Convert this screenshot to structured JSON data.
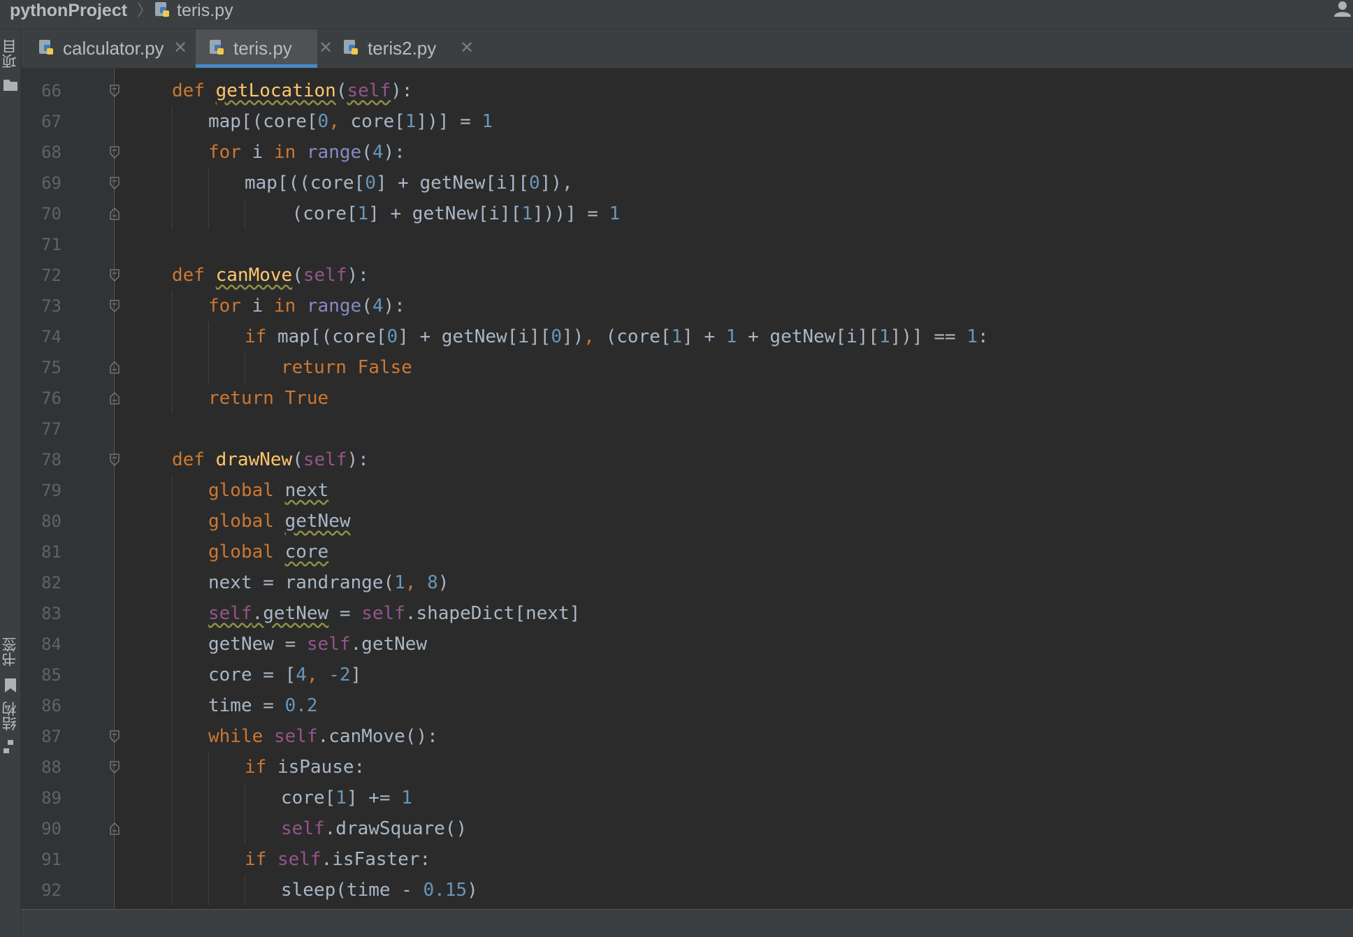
{
  "breadcrumb": {
    "project": "pythonProject",
    "file": "teris.py"
  },
  "tool_windows": {
    "project_label": "项目",
    "bookmarks_label": "书签",
    "structure_label": "结构"
  },
  "tabs": [
    {
      "label": "calculator.py",
      "active": false
    },
    {
      "label": "teris.py",
      "active": true
    },
    {
      "label": "teris2.py",
      "active": false
    }
  ],
  "colors": {
    "editor_bg": "#2b2b2b",
    "chrome_bg": "#3c3f41",
    "keyword": "#cc7832",
    "number": "#6897bb",
    "self": "#94558d",
    "function": "#ffc66d",
    "builtin": "#8888c6",
    "default": "#a9b7c6",
    "active_tab_underline": "#4a88c7"
  },
  "icons": [
    "python-file-icon",
    "close-icon",
    "user-icon",
    "folder-icon",
    "bookmark-icon",
    "structure-icon",
    "fold-icon"
  ],
  "code_lines": [
    {
      "n": "66",
      "indent": 1,
      "fold": "open",
      "tokens": [
        [
          "kw",
          "def"
        ],
        [
          "p",
          " "
        ],
        [
          "fnw",
          "getLocation"
        ],
        [
          "p",
          "("
        ],
        [
          "selfw",
          "self"
        ],
        [
          "p",
          "):"
        ]
      ]
    },
    {
      "n": "67",
      "indent": 2,
      "fold": "",
      "tokens": [
        [
          "p",
          "map[(core["
        ],
        [
          "num",
          "0"
        ],
        [
          "kw",
          ", "
        ],
        [
          "p",
          "core["
        ],
        [
          "num",
          "1"
        ],
        [
          "p",
          "])] = "
        ],
        [
          "num",
          "1"
        ]
      ]
    },
    {
      "n": "68",
      "indent": 2,
      "fold": "open",
      "tokens": [
        [
          "kw",
          "for"
        ],
        [
          "p",
          " i "
        ],
        [
          "kw",
          "in"
        ],
        [
          "p",
          " "
        ],
        [
          "bi",
          "range"
        ],
        [
          "p",
          "("
        ],
        [
          "num",
          "4"
        ],
        [
          "p",
          "):"
        ]
      ]
    },
    {
      "n": "69",
      "indent": 3,
      "fold": "open",
      "tokens": [
        [
          "p",
          "map[((core["
        ],
        [
          "num",
          "0"
        ],
        [
          "p",
          "] + getNew[i]["
        ],
        [
          "num",
          "0"
        ],
        [
          "p",
          "]),"
        ]
      ]
    },
    {
      "n": "70",
      "indent": 4.3,
      "fold": "close",
      "tokens": [
        [
          "p",
          "(core["
        ],
        [
          "num",
          "1"
        ],
        [
          "p",
          "] + getNew[i]["
        ],
        [
          "num",
          "1"
        ],
        [
          "p",
          "]))] = "
        ],
        [
          "num",
          "1"
        ]
      ]
    },
    {
      "n": "71",
      "indent": 0,
      "fold": "",
      "tokens": []
    },
    {
      "n": "72",
      "indent": 1,
      "fold": "open",
      "tokens": [
        [
          "kw",
          "def"
        ],
        [
          "p",
          " "
        ],
        [
          "fnw",
          "canMove"
        ],
        [
          "p",
          "("
        ],
        [
          "self",
          "self"
        ],
        [
          "p",
          "):"
        ]
      ]
    },
    {
      "n": "73",
      "indent": 2,
      "fold": "open",
      "tokens": [
        [
          "kw",
          "for"
        ],
        [
          "p",
          " i "
        ],
        [
          "kw",
          "in"
        ],
        [
          "p",
          " "
        ],
        [
          "bi",
          "range"
        ],
        [
          "p",
          "("
        ],
        [
          "num",
          "4"
        ],
        [
          "p",
          "):"
        ]
      ]
    },
    {
      "n": "74",
      "indent": 3,
      "fold": "",
      "tokens": [
        [
          "kw",
          "if"
        ],
        [
          "p",
          " map[(core["
        ],
        [
          "num",
          "0"
        ],
        [
          "p",
          "] + getNew[i]["
        ],
        [
          "num",
          "0"
        ],
        [
          "p",
          "])"
        ],
        [
          "kw",
          ", "
        ],
        [
          "p",
          "(core["
        ],
        [
          "num",
          "1"
        ],
        [
          "p",
          "] + "
        ],
        [
          "num",
          "1"
        ],
        [
          "p",
          " + getNew[i]["
        ],
        [
          "num",
          "1"
        ],
        [
          "p",
          "])] == "
        ],
        [
          "num",
          "1"
        ],
        [
          "p",
          ":"
        ]
      ]
    },
    {
      "n": "75",
      "indent": 4,
      "fold": "close",
      "tokens": [
        [
          "kw",
          "return False"
        ]
      ]
    },
    {
      "n": "76",
      "indent": 2,
      "fold": "close",
      "tokens": [
        [
          "kw",
          "return True"
        ]
      ]
    },
    {
      "n": "77",
      "indent": 0,
      "fold": "",
      "tokens": []
    },
    {
      "n": "78",
      "indent": 1,
      "fold": "open",
      "tokens": [
        [
          "kw",
          "def"
        ],
        [
          "p",
          " "
        ],
        [
          "fn",
          "drawNew"
        ],
        [
          "p",
          "("
        ],
        [
          "self",
          "self"
        ],
        [
          "p",
          "):"
        ]
      ]
    },
    {
      "n": "79",
      "indent": 2,
      "fold": "",
      "tokens": [
        [
          "kw",
          "global"
        ],
        [
          "p",
          " "
        ],
        [
          "w",
          "next"
        ]
      ]
    },
    {
      "n": "80",
      "indent": 2,
      "fold": "",
      "tokens": [
        [
          "kw",
          "global"
        ],
        [
          "p",
          " "
        ],
        [
          "w",
          "getNew"
        ]
      ]
    },
    {
      "n": "81",
      "indent": 2,
      "fold": "",
      "tokens": [
        [
          "kw",
          "global"
        ],
        [
          "p",
          " "
        ],
        [
          "w",
          "core"
        ]
      ]
    },
    {
      "n": "82",
      "indent": 2,
      "fold": "",
      "tokens": [
        [
          "p",
          "next = randrange("
        ],
        [
          "num",
          "1"
        ],
        [
          "kw",
          ", "
        ],
        [
          "num",
          "8"
        ],
        [
          "p",
          ")"
        ]
      ]
    },
    {
      "n": "83",
      "indent": 2,
      "fold": "",
      "tokens": [
        [
          "selfw",
          "self"
        ],
        [
          "w",
          ".getNew"
        ],
        [
          "p",
          " = "
        ],
        [
          "self",
          "self"
        ],
        [
          "p",
          ".shapeDict[next]"
        ]
      ]
    },
    {
      "n": "84",
      "indent": 2,
      "fold": "",
      "tokens": [
        [
          "p",
          "getNew = "
        ],
        [
          "self",
          "self"
        ],
        [
          "p",
          ".getNew"
        ]
      ]
    },
    {
      "n": "85",
      "indent": 2,
      "fold": "",
      "tokens": [
        [
          "p",
          "core = ["
        ],
        [
          "num",
          "4"
        ],
        [
          "kw",
          ", "
        ],
        [
          "num",
          "-2"
        ],
        [
          "p",
          "]"
        ]
      ]
    },
    {
      "n": "86",
      "indent": 2,
      "fold": "",
      "tokens": [
        [
          "p",
          "time = "
        ],
        [
          "num",
          "0.2"
        ]
      ]
    },
    {
      "n": "87",
      "indent": 2,
      "fold": "open",
      "tokens": [
        [
          "kw",
          "while"
        ],
        [
          "p",
          " "
        ],
        [
          "self",
          "self"
        ],
        [
          "p",
          ".canMove():"
        ]
      ]
    },
    {
      "n": "88",
      "indent": 3,
      "fold": "open",
      "tokens": [
        [
          "kw",
          "if"
        ],
        [
          "p",
          " isPause:"
        ]
      ]
    },
    {
      "n": "89",
      "indent": 4,
      "fold": "",
      "tokens": [
        [
          "p",
          "core["
        ],
        [
          "num",
          "1"
        ],
        [
          "p",
          "] += "
        ],
        [
          "num",
          "1"
        ]
      ]
    },
    {
      "n": "90",
      "indent": 4,
      "fold": "close",
      "tokens": [
        [
          "self",
          "self"
        ],
        [
          "p",
          ".drawSquare()"
        ]
      ]
    },
    {
      "n": "91",
      "indent": 3,
      "fold": "",
      "tokens": [
        [
          "kw",
          "if"
        ],
        [
          "p",
          " "
        ],
        [
          "self",
          "self"
        ],
        [
          "p",
          ".isFaster:"
        ]
      ]
    },
    {
      "n": "92",
      "indent": 4,
      "fold": "",
      "tokens": [
        [
          "p",
          "sleep(time - "
        ],
        [
          "num",
          "0.15"
        ],
        [
          "p",
          ")"
        ]
      ]
    }
  ]
}
